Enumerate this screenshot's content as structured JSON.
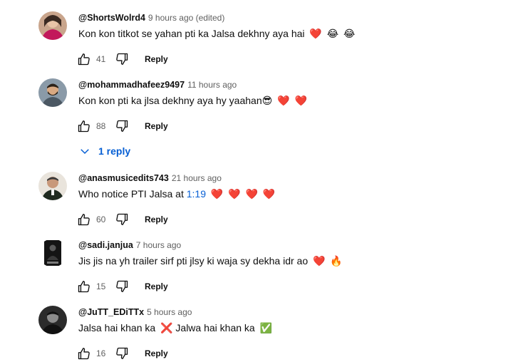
{
  "comments": [
    {
      "author": "@ShortsWolrd4",
      "time": "9 hours ago (edited)",
      "text": "Kon kon titkot se yahan pti ka Jalsa dekhny aya hai",
      "emoji": [
        "❤️",
        "😂",
        "😂"
      ],
      "likes": "41",
      "reply_label": "Reply"
    },
    {
      "author": "@mohammadhafeez9497",
      "time": "11 hours ago",
      "text": "Kon kon pti ka jlsa dekhny aya hy yaahan",
      "emoji": [
        "😎",
        "❤️",
        "❤️"
      ],
      "likes": "88",
      "reply_label": "Reply",
      "replies_label": "1 reply"
    },
    {
      "author": "@anasmusicedits743",
      "time": "21 hours ago",
      "text": "Who notice PTI Jalsa at ",
      "timestamp": "1:19",
      "emoji": [
        "❤️",
        "❤️",
        "❤️",
        "❤️"
      ],
      "likes": "60",
      "reply_label": "Reply"
    },
    {
      "author": "@sadi.janjua",
      "time": "7 hours ago",
      "text": "Jis jis na yh trailer sirf pti jlsy ki waja sy dekha idr ao",
      "emoji": [
        "❤️",
        "🔥"
      ],
      "likes": "15",
      "reply_label": "Reply"
    },
    {
      "author": "@JuTT_EDiTTx",
      "time": "5 hours ago",
      "text_a": "Jalsa hai khan ka",
      "emoji_a": "❌",
      "text_b": "Jalwa hai khan ka",
      "emoji_b": "✅",
      "likes": "16",
      "reply_label": "Reply"
    }
  ],
  "colors": {
    "link": "#065fd4",
    "secondary_text": "#606060",
    "primary_text": "#0f0f0f"
  },
  "icons": [
    "thumbs-up-icon",
    "thumbs-down-icon",
    "chevron-down-icon"
  ]
}
